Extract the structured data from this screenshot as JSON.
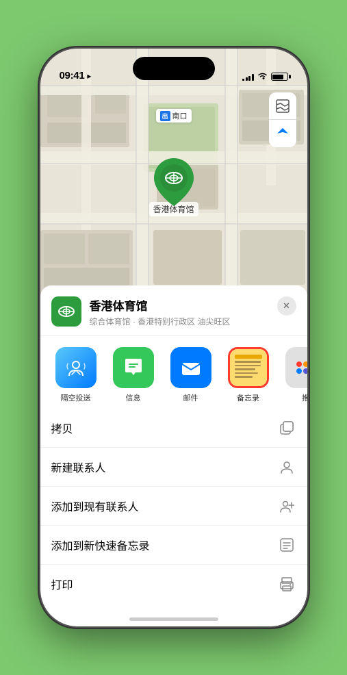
{
  "statusBar": {
    "time": "09:41",
    "location_arrow": "▶"
  },
  "map": {
    "label_nankou": "南口",
    "label_nankou_badge": "出",
    "marker_label": "香港体育馆"
  },
  "mapControls": {
    "map_btn_label": "🗺",
    "location_btn_label": "➤"
  },
  "locationCard": {
    "name": "香港体育馆",
    "description": "综合体育馆 · 香港特别行政区 油尖旺区",
    "close_label": "✕"
  },
  "shareItems": [
    {
      "id": "airdrop",
      "label": "隔空投送",
      "icon": "📡"
    },
    {
      "id": "messages",
      "label": "信息",
      "icon": "💬"
    },
    {
      "id": "mail",
      "label": "邮件",
      "icon": "✉️"
    },
    {
      "id": "notes",
      "label": "备忘录",
      "icon": "📝",
      "highlighted": true
    },
    {
      "id": "more",
      "label": "推",
      "icon": "···"
    }
  ],
  "actionItems": [
    {
      "id": "copy",
      "label": "拷贝",
      "icon": "copy"
    },
    {
      "id": "new-contact",
      "label": "新建联系人",
      "icon": "person"
    },
    {
      "id": "add-existing",
      "label": "添加到现有联系人",
      "icon": "person-add"
    },
    {
      "id": "add-notes",
      "label": "添加到新快速备忘录",
      "icon": "note"
    },
    {
      "id": "print",
      "label": "打印",
      "icon": "print"
    }
  ]
}
